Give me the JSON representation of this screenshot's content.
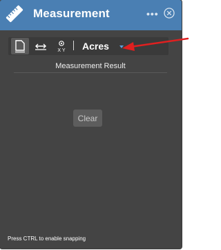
{
  "window": {
    "title": "Measurement",
    "more_glyph": "•••",
    "app_icon": "ruler-icon",
    "close_icon": "close-circle-icon",
    "header_color": "#4a7fb3"
  },
  "toolbar": {
    "tools": [
      {
        "name": "area-tool",
        "icon": "area-icon",
        "active": true
      },
      {
        "name": "distance-tool",
        "icon": "distance-icon",
        "active": false
      },
      {
        "name": "location-tool",
        "icon": "location-icon",
        "active": false,
        "label": "X Y"
      }
    ],
    "unit": {
      "value": "Acres",
      "arrow_color": "#5aa0dd"
    }
  },
  "result": {
    "heading": "Measurement Result"
  },
  "clear_button": {
    "label": "Clear"
  },
  "hint": "Press CTRL to enable snapping",
  "annotation": {
    "color": "#e02020"
  }
}
